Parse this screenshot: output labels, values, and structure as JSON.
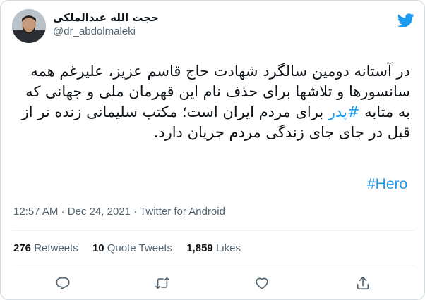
{
  "author": {
    "display_name": "حجت الله عبدالملکی",
    "handle": "@dr_abdolmaleki"
  },
  "tweet": {
    "text_part1": "در آستانه دومین سالگرد شهادت حاج قاسم عزیز، علیرغم همه سانسورها و تلاشها برای حذف نام این قهرمان ملی و جهانی که به مثابه ",
    "hashtag_pedar": "#پدر",
    "text_part2": " برای مردم ایران است؛ مکتب سلیمانی زنده تر از قبل در جای جای زندگی مردم جریان دارد.",
    "hashtag_hero": "#Hero"
  },
  "meta": {
    "time": "12:57 AM",
    "separator": "·",
    "date": "Dec 24, 2021",
    "source": "Twitter for Android"
  },
  "stats": {
    "retweets_count": "276",
    "retweets_label": "Retweets",
    "quotes_count": "10",
    "quotes_label": "Quote Tweets",
    "likes_count": "1,859",
    "likes_label": "Likes"
  },
  "icons": {
    "logo": "twitter-logo-icon",
    "reply": "reply-icon",
    "retweet": "retweet-icon",
    "like": "like-icon",
    "share": "share-icon"
  },
  "colors": {
    "accent": "#1d9bf0",
    "text": "#0f1419",
    "secondary": "#536471",
    "border": "#cfd9de"
  }
}
